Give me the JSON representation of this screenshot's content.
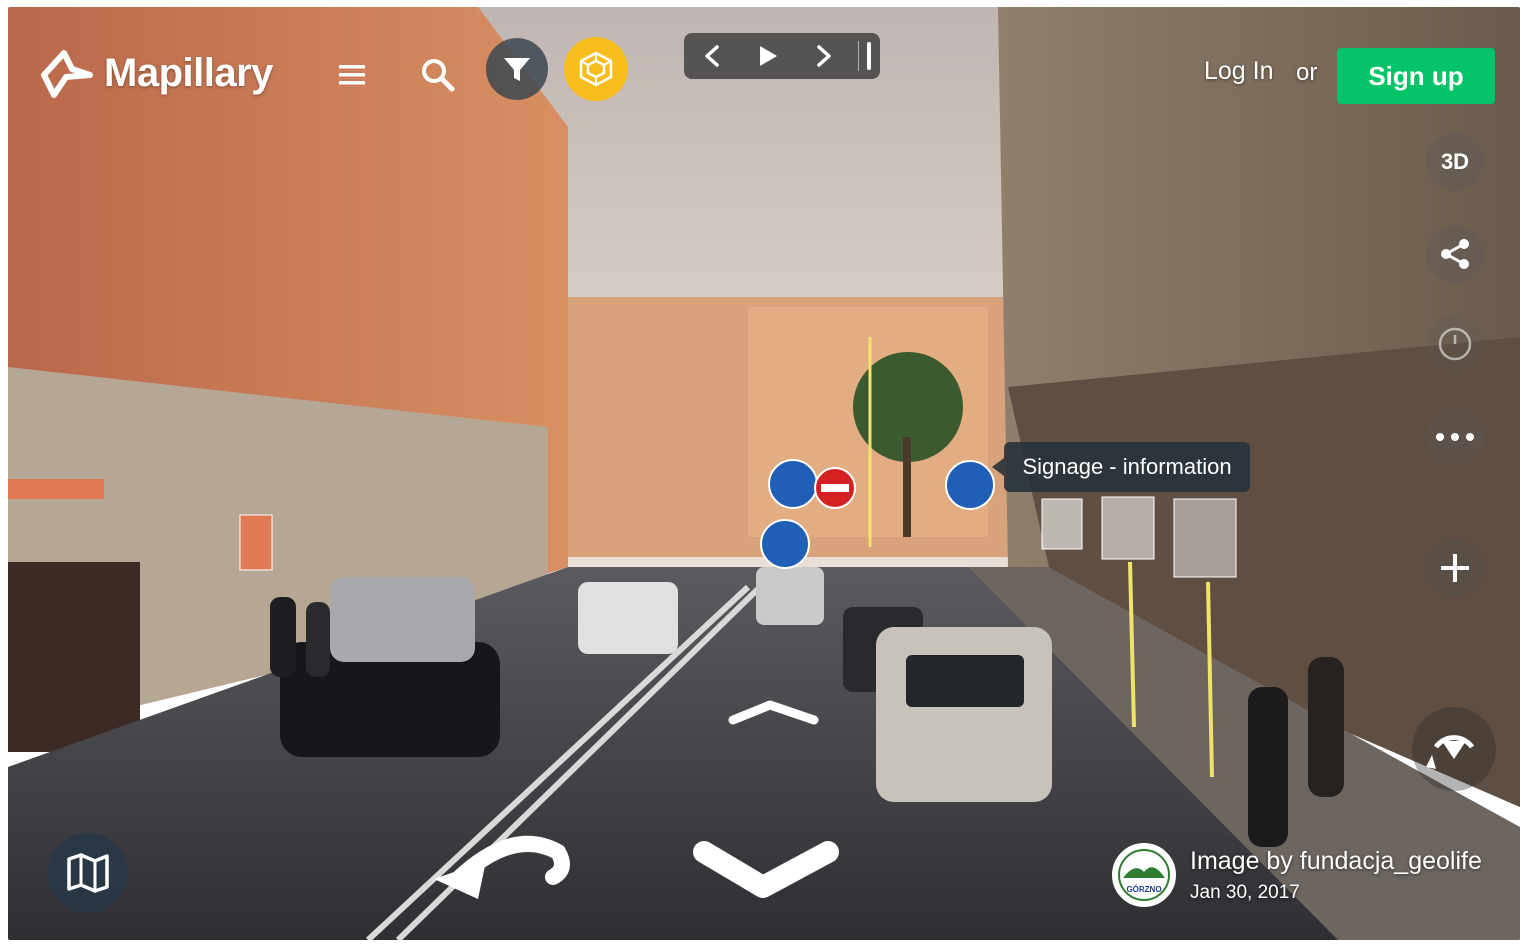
{
  "app": {
    "brand": "Mapillary"
  },
  "toolbar": {
    "menu_icon": "menu-icon",
    "search_icon": "search-icon",
    "filter_icon": "filter-icon",
    "detections_icon": "detections-cube-icon",
    "accent_yellow": "#f6bd1c"
  },
  "sequence_controls": {
    "prev_icon": "chevron-left-icon",
    "play_icon": "play-icon",
    "next_icon": "chevron-right-icon"
  },
  "auth": {
    "login_label": "Log In",
    "or_label": "or",
    "signup_label": "Sign up",
    "signup_color": "#05c369"
  },
  "side_controls": {
    "mode_3d_label": "3D",
    "share_icon": "share-icon",
    "timeline_icon": "clock-icon",
    "more_icon": "more-icon",
    "zoom_in_icon": "plus-icon",
    "compass_icon": "compass-icon"
  },
  "detection_tooltip": {
    "label": "Signage - information"
  },
  "navigation": {
    "forward_icon": "arrow-up-icon",
    "back_icon": "arrow-down-icon",
    "turn_icon": "turn-left-icon",
    "map_icon": "map-icon"
  },
  "attribution": {
    "image_by": "Image by fundacja_geolife",
    "date": "Jan 30, 2017",
    "avatar_text": "GÓRZNO"
  }
}
